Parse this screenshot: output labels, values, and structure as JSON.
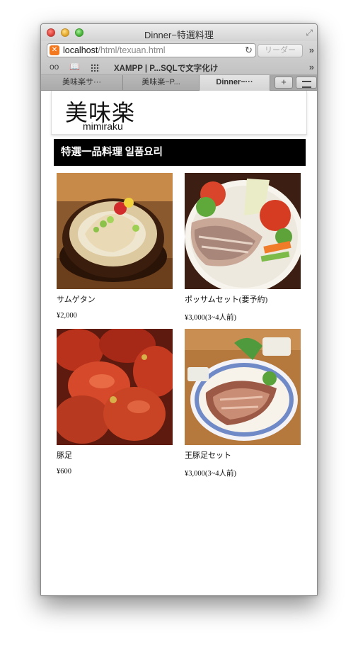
{
  "window": {
    "title": "Dinner−特選料理"
  },
  "toolbar": {
    "url_host": "localhost",
    "url_path": "/html/texuan.html",
    "reader_label": "リーダー",
    "overflow_glyph": "»"
  },
  "bookmarks": {
    "items": [
      {
        "label": "XAMPP | P...SQLで文字化け"
      }
    ]
  },
  "tabs": [
    {
      "label": "美味楽サ···",
      "active": false
    },
    {
      "label": "美味楽−P...",
      "active": false
    },
    {
      "label": "Dinner−···",
      "active": true
    }
  ],
  "page": {
    "logo": {
      "kanji": "美味楽",
      "romaji": "mimiraku"
    },
    "section_title": "特選一品料理 일품요리",
    "menu_items": [
      {
        "name": "サムゲタン",
        "price": "¥2,000",
        "photo": "samgyetang-photo"
      },
      {
        "name": "ポッサムセット(要予約)",
        "price": "¥3,000(3~4人前)",
        "photo": "bossam-photo"
      },
      {
        "name": "豚足",
        "price": "¥600",
        "photo": "pork-feet-photo"
      },
      {
        "name": "王豚足セット",
        "price": "¥3,000(3~4人前)",
        "photo": "jokbal-set-photo"
      }
    ]
  },
  "colors": {
    "section_header_bg": "#000000",
    "xampp_orange": "#f2791f"
  }
}
